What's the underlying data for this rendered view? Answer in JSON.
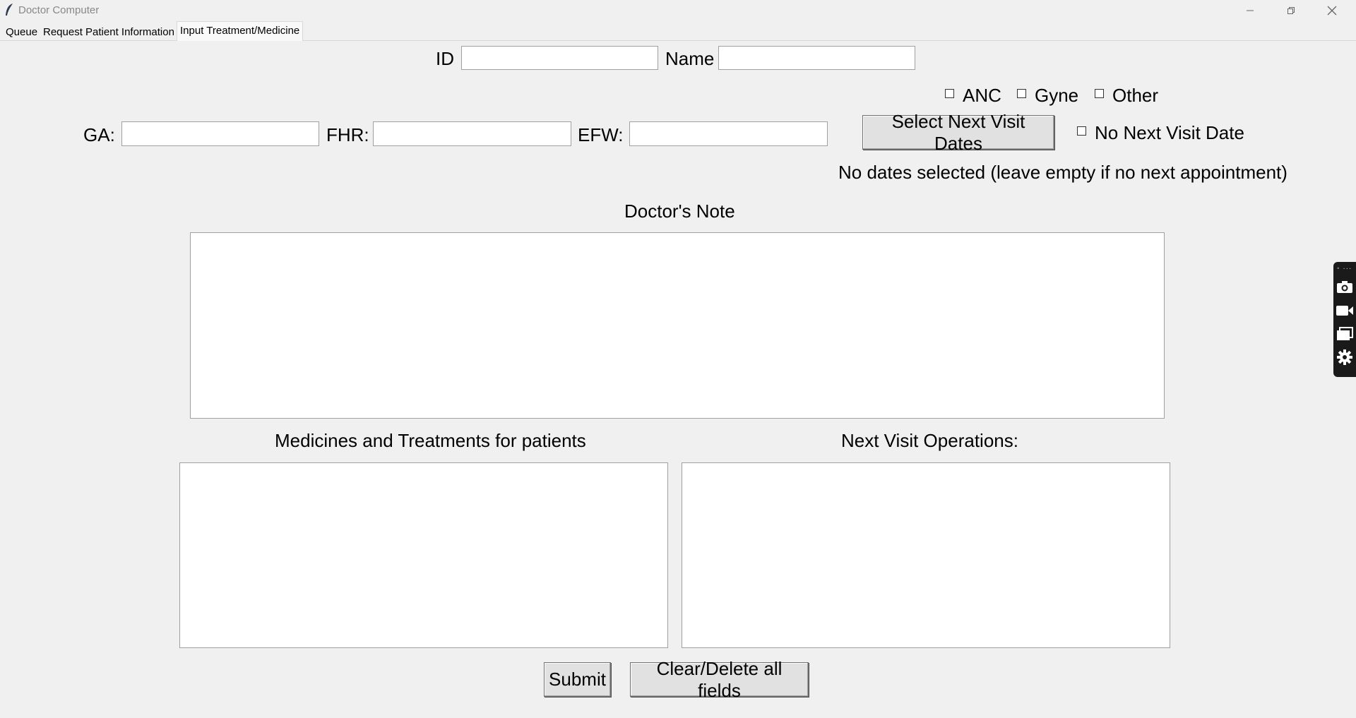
{
  "window": {
    "title": "Doctor Computer",
    "minimize_icon": "minimize-icon",
    "restore_icon": "restore-icon",
    "close_icon": "close-icon"
  },
  "tabs": [
    {
      "label": "Queue",
      "active": false
    },
    {
      "label": "Request Patient Information",
      "active": false
    },
    {
      "label": "Input Treatment/Medicine",
      "active": true
    }
  ],
  "form": {
    "id_label": "ID",
    "id_value": "",
    "name_label": "Name",
    "name_value": "",
    "checks": {
      "anc": {
        "label": "ANC",
        "checked": false
      },
      "gyne": {
        "label": "Gyne",
        "checked": false
      },
      "other": {
        "label": "Other",
        "checked": false
      },
      "no_next_visit": {
        "label": "No Next Visit Date",
        "checked": false
      }
    },
    "ga_label": "GA:",
    "ga_value": "",
    "fhr_label": "FHR:",
    "fhr_value": "",
    "efw_label": "EFW:",
    "efw_value": "",
    "select_dates_button": "Select Next Visit Dates",
    "dates_status": "No dates selected (leave empty if no next appointment)",
    "doctors_note_label": "Doctor's Note",
    "doctors_note_value": "",
    "medicines_label": "Medicines and Treatments for patients",
    "medicines_value": "",
    "next_visit_ops_label": "Next Visit Operations:",
    "next_visit_ops_value": "",
    "submit_button": "Submit",
    "clear_button": "Clear/Delete all fields"
  },
  "side_toolbar": {
    "icons": [
      "camera-icon",
      "video-icon",
      "window-icon",
      "gear-icon"
    ]
  }
}
